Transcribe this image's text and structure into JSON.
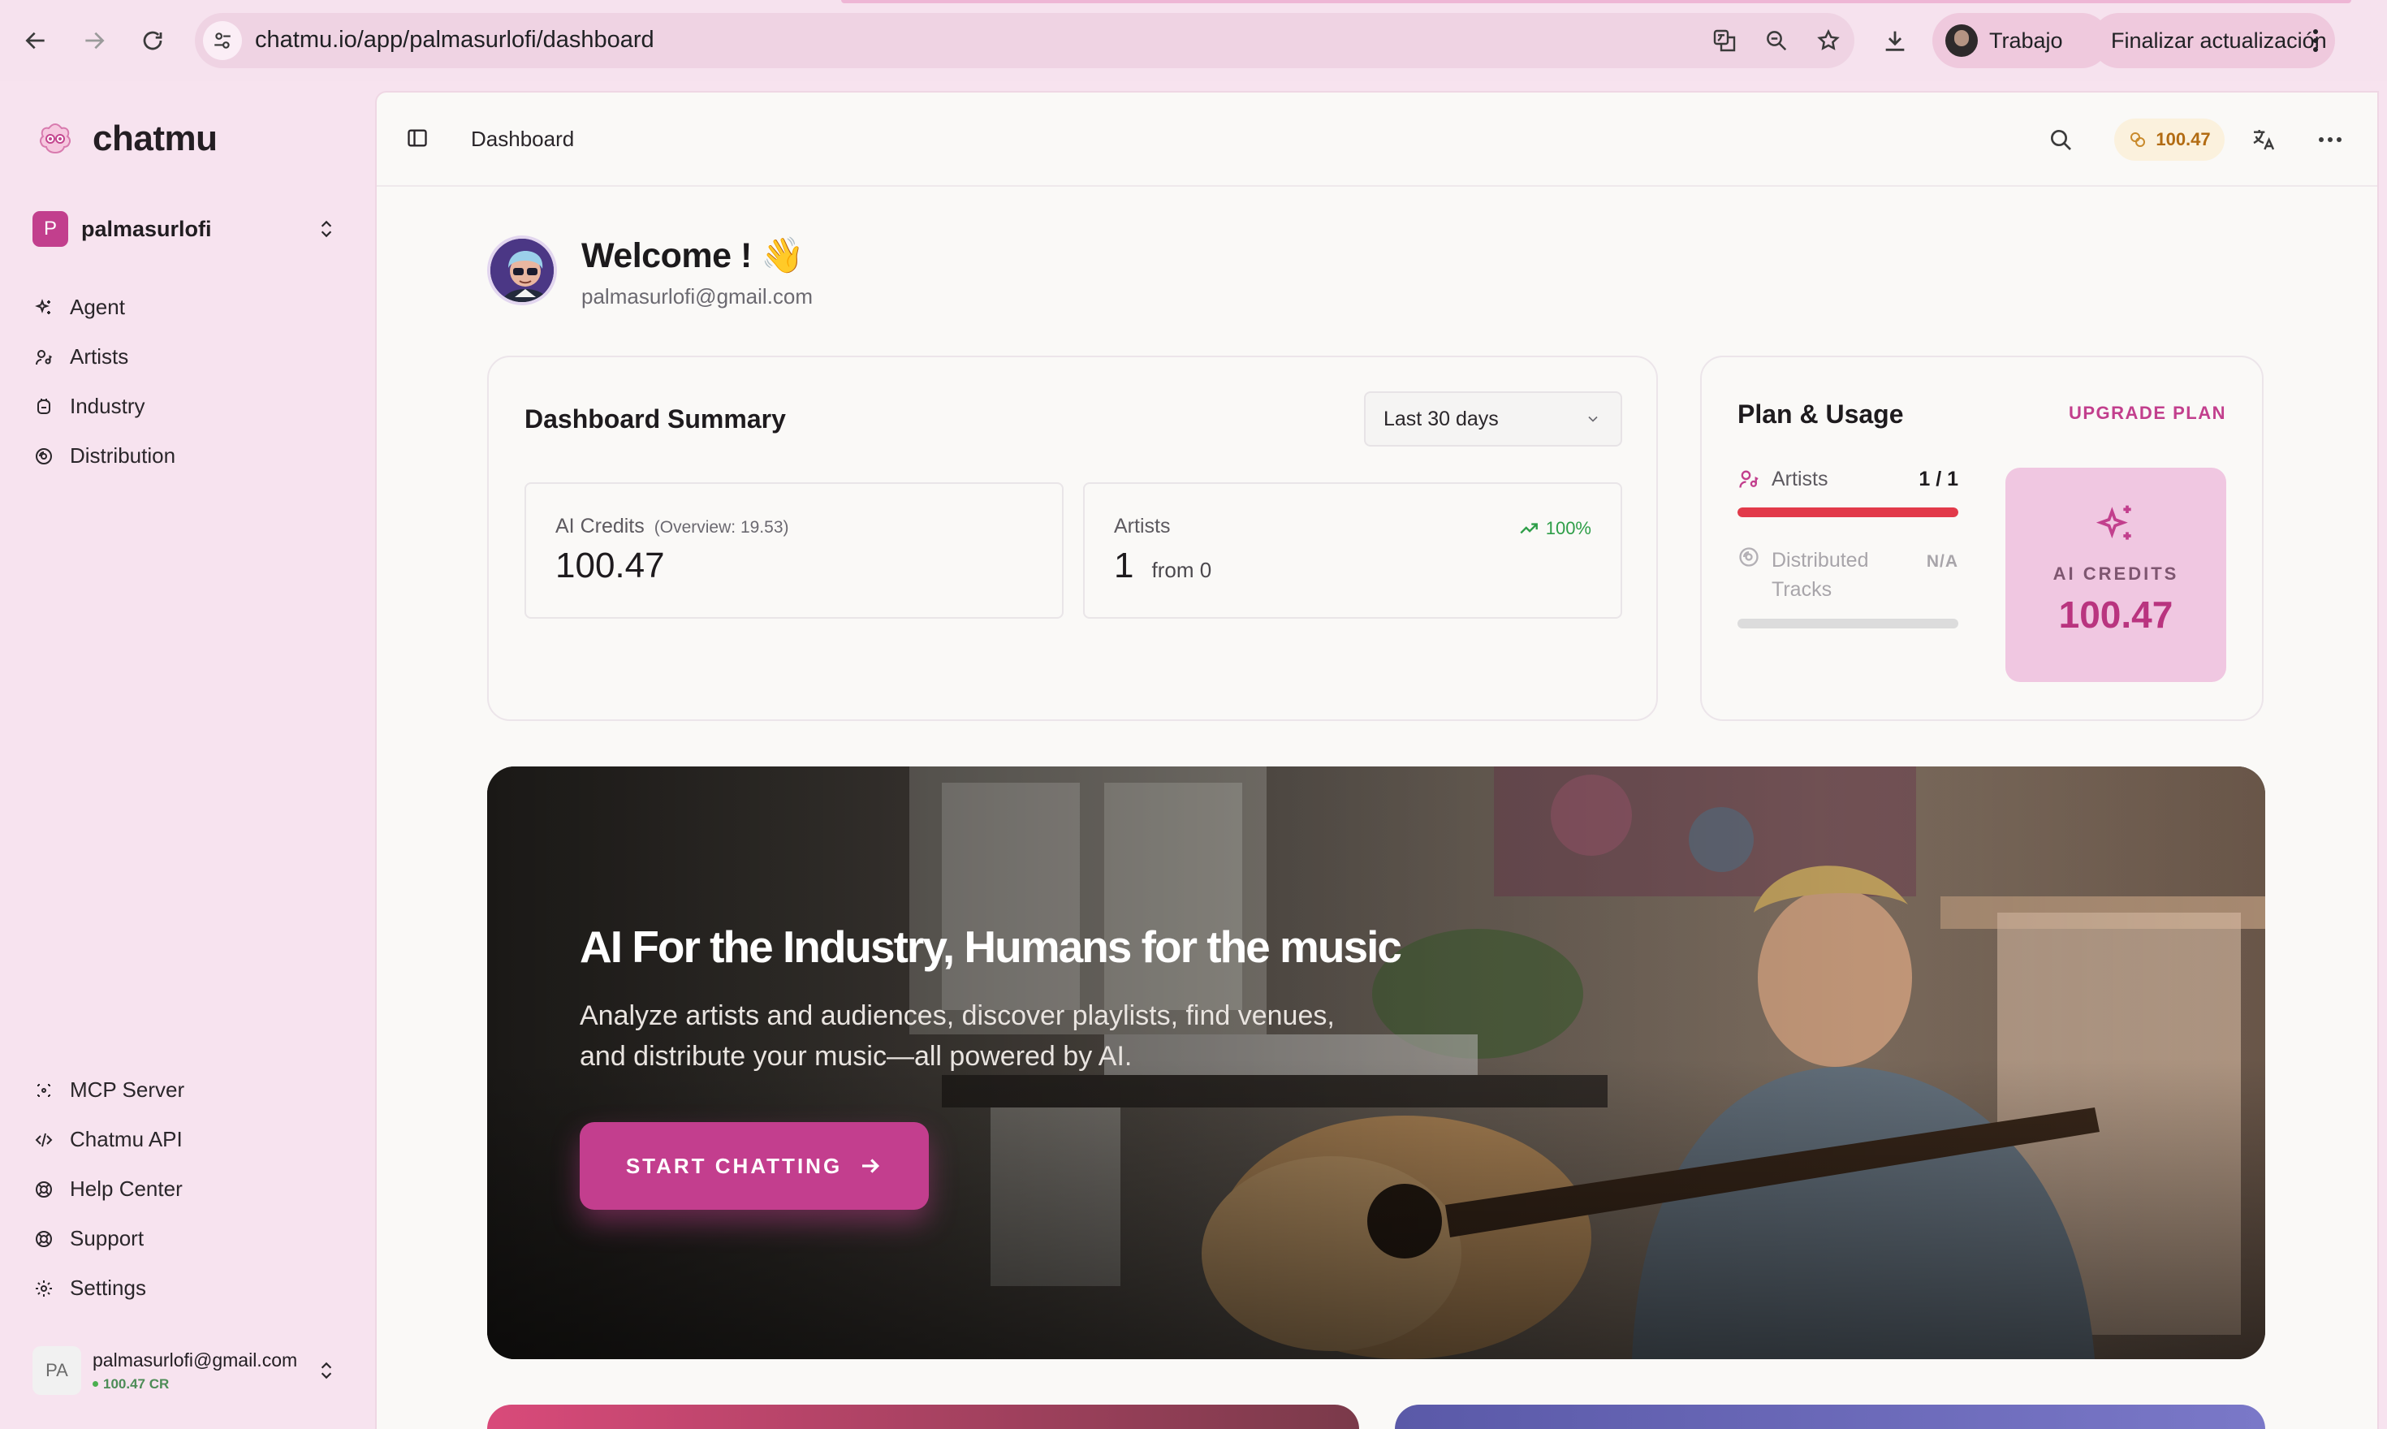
{
  "browser": {
    "url": "chatmu.io/app/palmasurlofi/dashboard",
    "profile_label": "Trabajo",
    "update_label": "Finalizar actualización"
  },
  "sidebar": {
    "brand": "chatmu",
    "workspace": {
      "badge": "P",
      "name": "palmasurlofi"
    },
    "primary_items": [
      {
        "label": "Agent",
        "icon": "sparkle-icon"
      },
      {
        "label": "Artists",
        "icon": "artist-icon"
      },
      {
        "label": "Industry",
        "icon": "industry-icon"
      },
      {
        "label": "Distribution",
        "icon": "distribution-icon"
      }
    ],
    "secondary_items": [
      {
        "label": "MCP Server",
        "icon": "mcp-icon"
      },
      {
        "label": "Chatmu API",
        "icon": "code-icon"
      },
      {
        "label": "Help Center",
        "icon": "lifebuoy-icon"
      },
      {
        "label": "Support",
        "icon": "support-icon"
      },
      {
        "label": "Settings",
        "icon": "gear-icon"
      }
    ],
    "user": {
      "initials": "PA",
      "email": "palmasurlofi@gmail.com",
      "credits": "100.47 CR"
    }
  },
  "topbar": {
    "breadcrumb": "Dashboard",
    "credits": "100.47"
  },
  "welcome": {
    "title": "Welcome ! 👋",
    "email": "palmasurlofi@gmail.com"
  },
  "summary": {
    "title": "Dashboard Summary",
    "range": "Last 30 days",
    "ai_credits": {
      "label": "AI Credits",
      "sub": "(Overview: 19.53)",
      "value": "100.47"
    },
    "artists": {
      "label": "Artists",
      "value": "1",
      "from": "from 0",
      "trend": "100%"
    }
  },
  "plan": {
    "title": "Plan & Usage",
    "upgrade": "UPGRADE PLAN",
    "artists": {
      "label": "Artists",
      "value": "1 / 1",
      "fraction": 1.0
    },
    "tracks": {
      "label": "Distributed Tracks",
      "value": "N/A",
      "fraction": 0
    },
    "credits_label": "AI CREDITS",
    "credits_value": "100.47"
  },
  "hero": {
    "title": "AI For the Industry, Humans for the music",
    "description": "Analyze artists and audiences, discover playlists, find venues, and distribute your music—all powered by AI.",
    "cta": "START CHATTING"
  },
  "colors": {
    "accent": "#c33e8e",
    "sidebar_bg": "#f7e3ef",
    "danger_bar": "#e23a4a",
    "trend_green": "#2e9e48",
    "credit_amber": "#b26b12"
  }
}
